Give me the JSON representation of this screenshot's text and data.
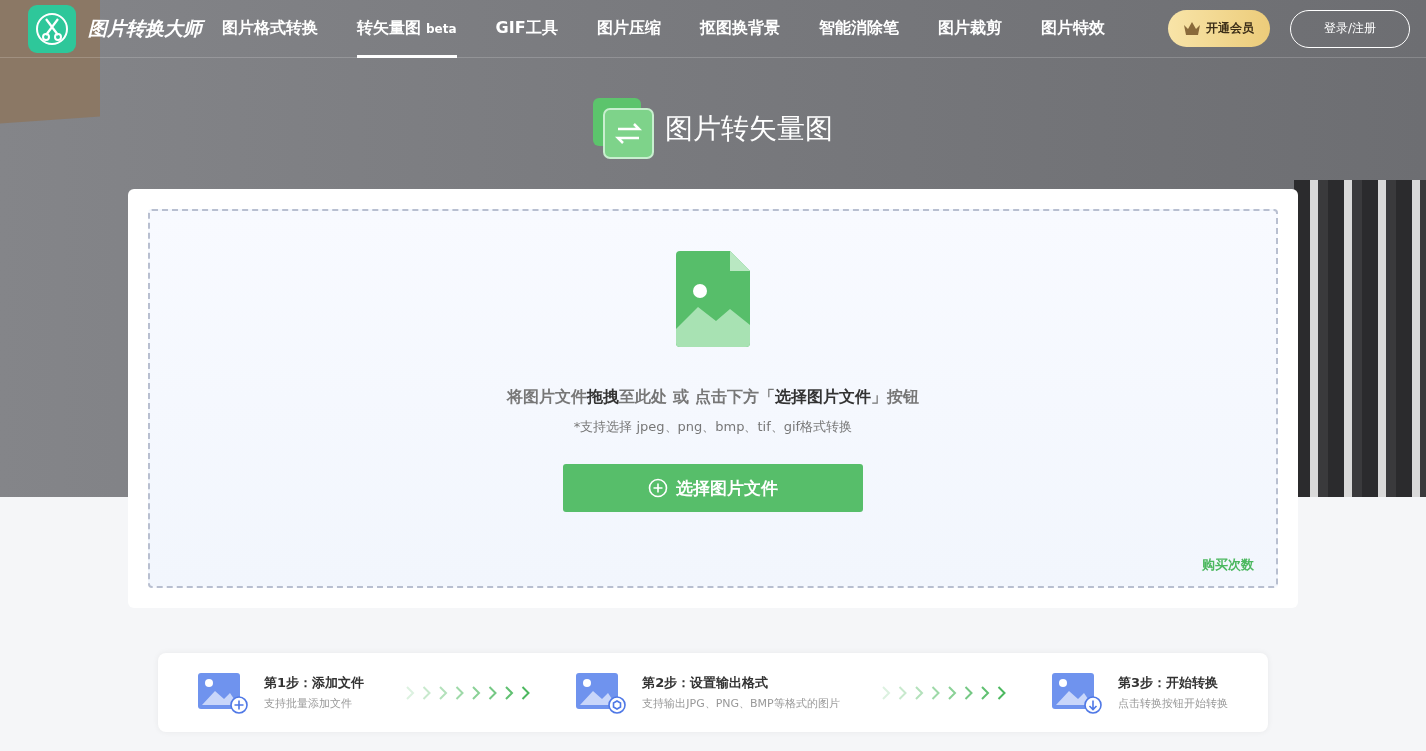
{
  "brand": {
    "name": "图片转换大师"
  },
  "nav": [
    {
      "label": "图片格式转换",
      "selected": false
    },
    {
      "label": "转矢量图",
      "badge": "beta",
      "selected": true
    },
    {
      "label": "GIF工具",
      "selected": false
    },
    {
      "label": "图片压缩",
      "selected": false
    },
    {
      "label": "抠图换背景",
      "selected": false
    },
    {
      "label": "智能消除笔",
      "selected": false
    },
    {
      "label": "图片裁剪",
      "selected": false
    },
    {
      "label": "图片特效",
      "selected": false
    }
  ],
  "vip_button": "开通会员",
  "login_button": "登录/注册",
  "page_title": "图片转矢量图",
  "upload": {
    "instruction": "将图片文件**拖拽**至此处 或 点击下方「**选择图片文件**」按钮",
    "formats": "*支持选择 jpeg、png、bmp、tif、gif格式转换",
    "button": "选择图片文件",
    "purchase_link": "购买次数"
  },
  "steps": [
    {
      "kind": "add",
      "title": "第1步：添加文件",
      "desc": "支持批量添加文件"
    },
    {
      "kind": "settings",
      "title": "第2步：设置输出格式",
      "desc": "支持输出JPG、PNG、BMP等格式的图片"
    },
    {
      "kind": "download",
      "title": "第3步：开始转换",
      "desc": "点击转换按钮开始转换"
    }
  ]
}
